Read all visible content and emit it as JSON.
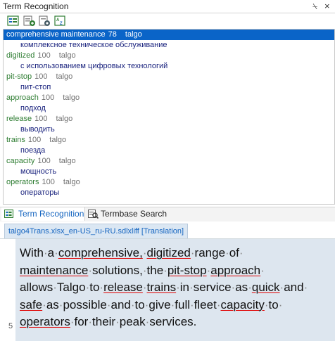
{
  "panel": {
    "title": "Term Recognition",
    "pin_glyph": "⍀",
    "close_glyph": "×"
  },
  "toolbar": {
    "buttons": [
      "term-list-icon",
      "add-term-icon",
      "settings-icon",
      "sort-az-icon"
    ]
  },
  "terms": [
    {
      "source": "comprehensive maintenance",
      "score": "78",
      "termbase": "talgo",
      "target": "комплексное техническое обслуживание",
      "selected": true
    },
    {
      "source": "digitized",
      "score": "100",
      "termbase": "talgo",
      "target": "с использованием цифровых технологий",
      "selected": false
    },
    {
      "source": "pit-stop",
      "score": "100",
      "termbase": "talgo",
      "target": "пит-стоп",
      "selected": false
    },
    {
      "source": "approach",
      "score": "100",
      "termbase": "talgo",
      "target": "подход",
      "selected": false
    },
    {
      "source": "release",
      "score": "100",
      "termbase": "talgo",
      "target": "выводить",
      "selected": false
    },
    {
      "source": "trains",
      "score": "100",
      "termbase": "talgo",
      "target": "поезда",
      "selected": false
    },
    {
      "source": "capacity",
      "score": "100",
      "termbase": "talgo",
      "target": "мощность",
      "selected": false
    },
    {
      "source": "operators",
      "score": "100",
      "termbase": "talgo",
      "target": "операторы",
      "selected": false
    }
  ],
  "tabs": {
    "term_recognition": "Term Recognition",
    "termbase_search": "Termbase Search"
  },
  "document": {
    "tab_label": "talgo4Trans.xlsx_en-US_ru-RU.sdlxliff [Translation]",
    "segment_number": "5",
    "lines": [
      [
        [
          "With",
          "n"
        ],
        [
          "·",
          "d"
        ],
        [
          "a",
          "n"
        ],
        [
          "·",
          "d"
        ],
        [
          "comprehensive,",
          "u"
        ],
        [
          "·",
          "d"
        ],
        [
          "digitized",
          "u"
        ],
        [
          "·",
          "d"
        ],
        [
          "range",
          "n"
        ],
        [
          "·",
          "d"
        ],
        [
          "of",
          "n"
        ],
        [
          "·",
          "d"
        ]
      ],
      [
        [
          "maintenance",
          "u"
        ],
        [
          "·",
          "d"
        ],
        [
          "solutions,",
          "n"
        ],
        [
          "·",
          "d"
        ],
        [
          "the",
          "n"
        ],
        [
          "·",
          "d"
        ],
        [
          "pit-stop",
          "u"
        ],
        [
          "·",
          "d"
        ],
        [
          "approach",
          "u"
        ],
        [
          "·",
          "d"
        ]
      ],
      [
        [
          "allows",
          "n"
        ],
        [
          "·",
          "d"
        ],
        [
          "Talgo",
          "n"
        ],
        [
          "·",
          "d"
        ],
        [
          "to",
          "n"
        ],
        [
          "·",
          "d"
        ],
        [
          "release",
          "u"
        ],
        [
          "·",
          "d"
        ],
        [
          "trains",
          "u"
        ],
        [
          "·",
          "d"
        ],
        [
          "in",
          "n"
        ],
        [
          "·",
          "d"
        ],
        [
          "service",
          "n"
        ],
        [
          "·",
          "d"
        ],
        [
          "as",
          "n"
        ],
        [
          "·",
          "d"
        ],
        [
          "quick",
          "u"
        ],
        [
          "·",
          "d"
        ],
        [
          "and",
          "n"
        ],
        [
          "·",
          "d"
        ]
      ],
      [
        [
          "safe",
          "u"
        ],
        [
          "·",
          "d"
        ],
        [
          "as",
          "n"
        ],
        [
          "·",
          "d"
        ],
        [
          "possible",
          "n"
        ],
        [
          "·",
          "d"
        ],
        [
          "and",
          "n"
        ],
        [
          "·",
          "d"
        ],
        [
          "to",
          "n"
        ],
        [
          "·",
          "d"
        ],
        [
          "give",
          "n"
        ],
        [
          "·",
          "d"
        ],
        [
          "full",
          "n"
        ],
        [
          "·",
          "d"
        ],
        [
          "fleet",
          "n"
        ],
        [
          "·",
          "d"
        ],
        [
          "capacity",
          "u"
        ],
        [
          "·",
          "d"
        ],
        [
          "to",
          "n"
        ],
        [
          "·",
          "d"
        ]
      ],
      [
        [
          "operators",
          "u"
        ],
        [
          "·",
          "d"
        ],
        [
          "for",
          "n"
        ],
        [
          "·",
          "d"
        ],
        [
          "their",
          "n"
        ],
        [
          "·",
          "d"
        ],
        [
          "peak",
          "n"
        ],
        [
          "·",
          "d"
        ],
        [
          "services.",
          "n"
        ]
      ]
    ]
  },
  "colors": {
    "selection": "#0a64c8",
    "source_term": "#2e7d32",
    "target_term": "#1a237e",
    "segment_bg": "#dde6ef",
    "spell_underline": "#e00000"
  }
}
